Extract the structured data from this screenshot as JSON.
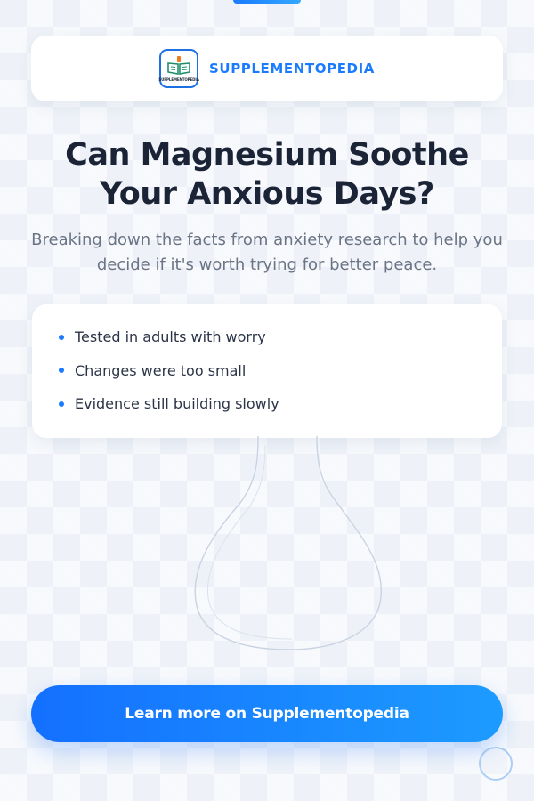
{
  "brand": {
    "name": "SUPPLEMENTOPEDIA",
    "logo_text": "SUPPLEMENTOPEDIA",
    "logo_icon": "open-book-icon",
    "accent_color": "#1a7bff"
  },
  "headline": "Can Magnesium Soothe Your Anxious Days?",
  "subheadline": "Breaking down the facts from anxiety research to help you decide if it's worth trying for better peace.",
  "points": [
    "Tested in adults with worry",
    "Changes were too small",
    "Evidence still building slowly"
  ],
  "cta": {
    "label": "Learn more on Supplementopedia"
  },
  "colors": {
    "background": "#eef2f8",
    "headline": "#1b2436",
    "subheadline": "#6b7485",
    "button_start": "#1470ff",
    "button_end": "#1d9bff"
  }
}
